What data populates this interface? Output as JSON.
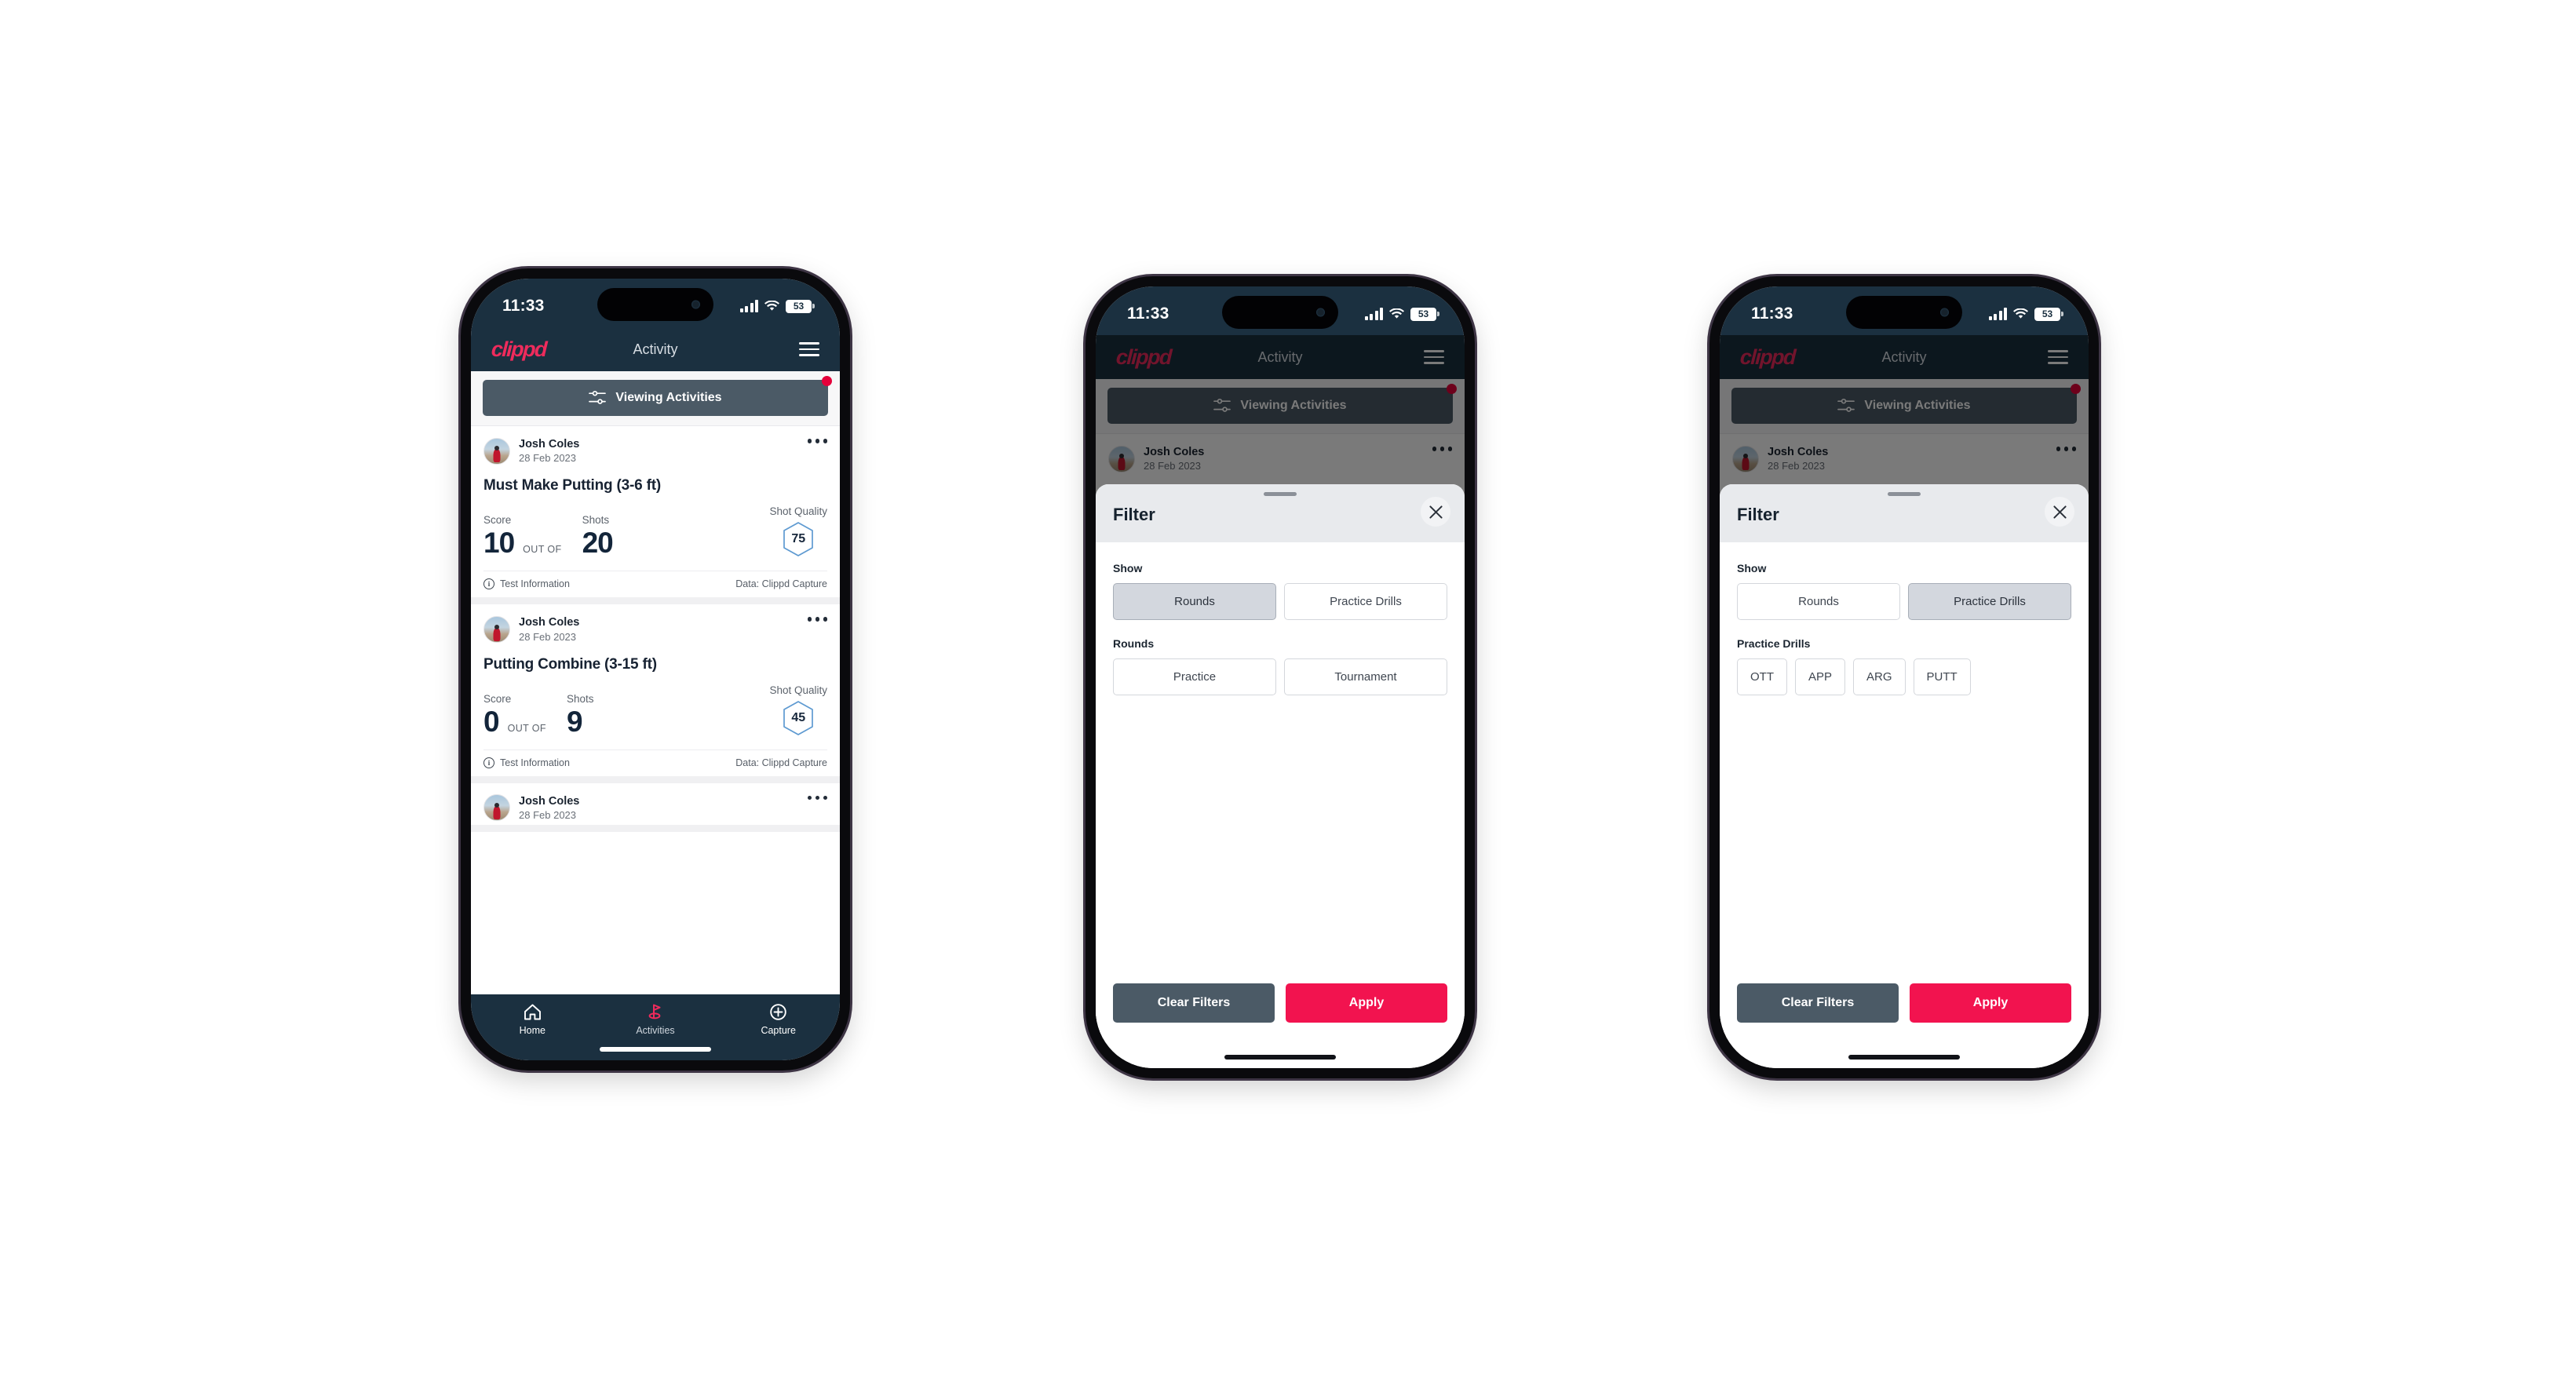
{
  "status_bar": {
    "time": "11:33",
    "battery": "53",
    "signal_icon": "cellular-signal-icon",
    "wifi_icon": "wifi-icon",
    "battery_icon": "battery-icon"
  },
  "app_bar": {
    "logo": "clippd",
    "title": "Activity",
    "menu_icon": "hamburger-menu-icon"
  },
  "filter_bar": {
    "label": "Viewing Activities",
    "icon": "tune-filter-icon",
    "has_notification": true
  },
  "feed": {
    "cards": [
      {
        "author": "Josh Coles",
        "date": "28 Feb 2023",
        "title": "Must Make Putting (3-6 ft)",
        "score_label": "Score",
        "score_value": "10",
        "out_of_label": "OUT OF",
        "shots_label": "Shots",
        "shots_value": "20",
        "quality_label": "Shot Quality",
        "quality_value": "75",
        "info_label": "Test Information",
        "data_label": "Data: Clippd Capture"
      },
      {
        "author": "Josh Coles",
        "date": "28 Feb 2023",
        "title": "Putting Combine (3-15 ft)",
        "score_label": "Score",
        "score_value": "0",
        "out_of_label": "OUT OF",
        "shots_label": "Shots",
        "shots_value": "9",
        "quality_label": "Shot Quality",
        "quality_value": "45",
        "info_label": "Test Information",
        "data_label": "Data: Clippd Capture"
      },
      {
        "author": "Josh Coles",
        "date": "28 Feb 2023"
      }
    ]
  },
  "bottom_nav": {
    "items": [
      {
        "label": "Home",
        "icon": "home-icon",
        "active": false
      },
      {
        "label": "Activities",
        "icon": "golf-flag-icon",
        "active": true
      },
      {
        "label": "Capture",
        "icon": "plus-circle-icon",
        "active": false
      }
    ]
  },
  "filter_sheet_rounds": {
    "title": "Filter",
    "close_icon": "close-x-icon",
    "show_label": "Show",
    "show_options": [
      {
        "label": "Rounds",
        "selected": true
      },
      {
        "label": "Practice Drills",
        "selected": false
      }
    ],
    "section_label": "Rounds",
    "section_options": [
      {
        "label": "Practice",
        "selected": false
      },
      {
        "label": "Tournament",
        "selected": false
      }
    ],
    "clear_label": "Clear Filters",
    "apply_label": "Apply"
  },
  "filter_sheet_drills": {
    "title": "Filter",
    "close_icon": "close-x-icon",
    "show_label": "Show",
    "show_options": [
      {
        "label": "Rounds",
        "selected": false
      },
      {
        "label": "Practice Drills",
        "selected": true
      }
    ],
    "section_label": "Practice Drills",
    "section_options": [
      {
        "label": "OTT",
        "selected": false
      },
      {
        "label": "APP",
        "selected": false
      },
      {
        "label": "ARG",
        "selected": false
      },
      {
        "label": "PUTT",
        "selected": false
      }
    ],
    "clear_label": "Clear Filters",
    "apply_label": "Apply"
  },
  "colors": {
    "brand_pink": "#ef2b5c",
    "apply_pink": "#f2134f",
    "header_navy": "#1b3040",
    "slate": "#4b5a66",
    "hex_blue": "#5e9ad1",
    "notification_red": "#e4003a"
  }
}
